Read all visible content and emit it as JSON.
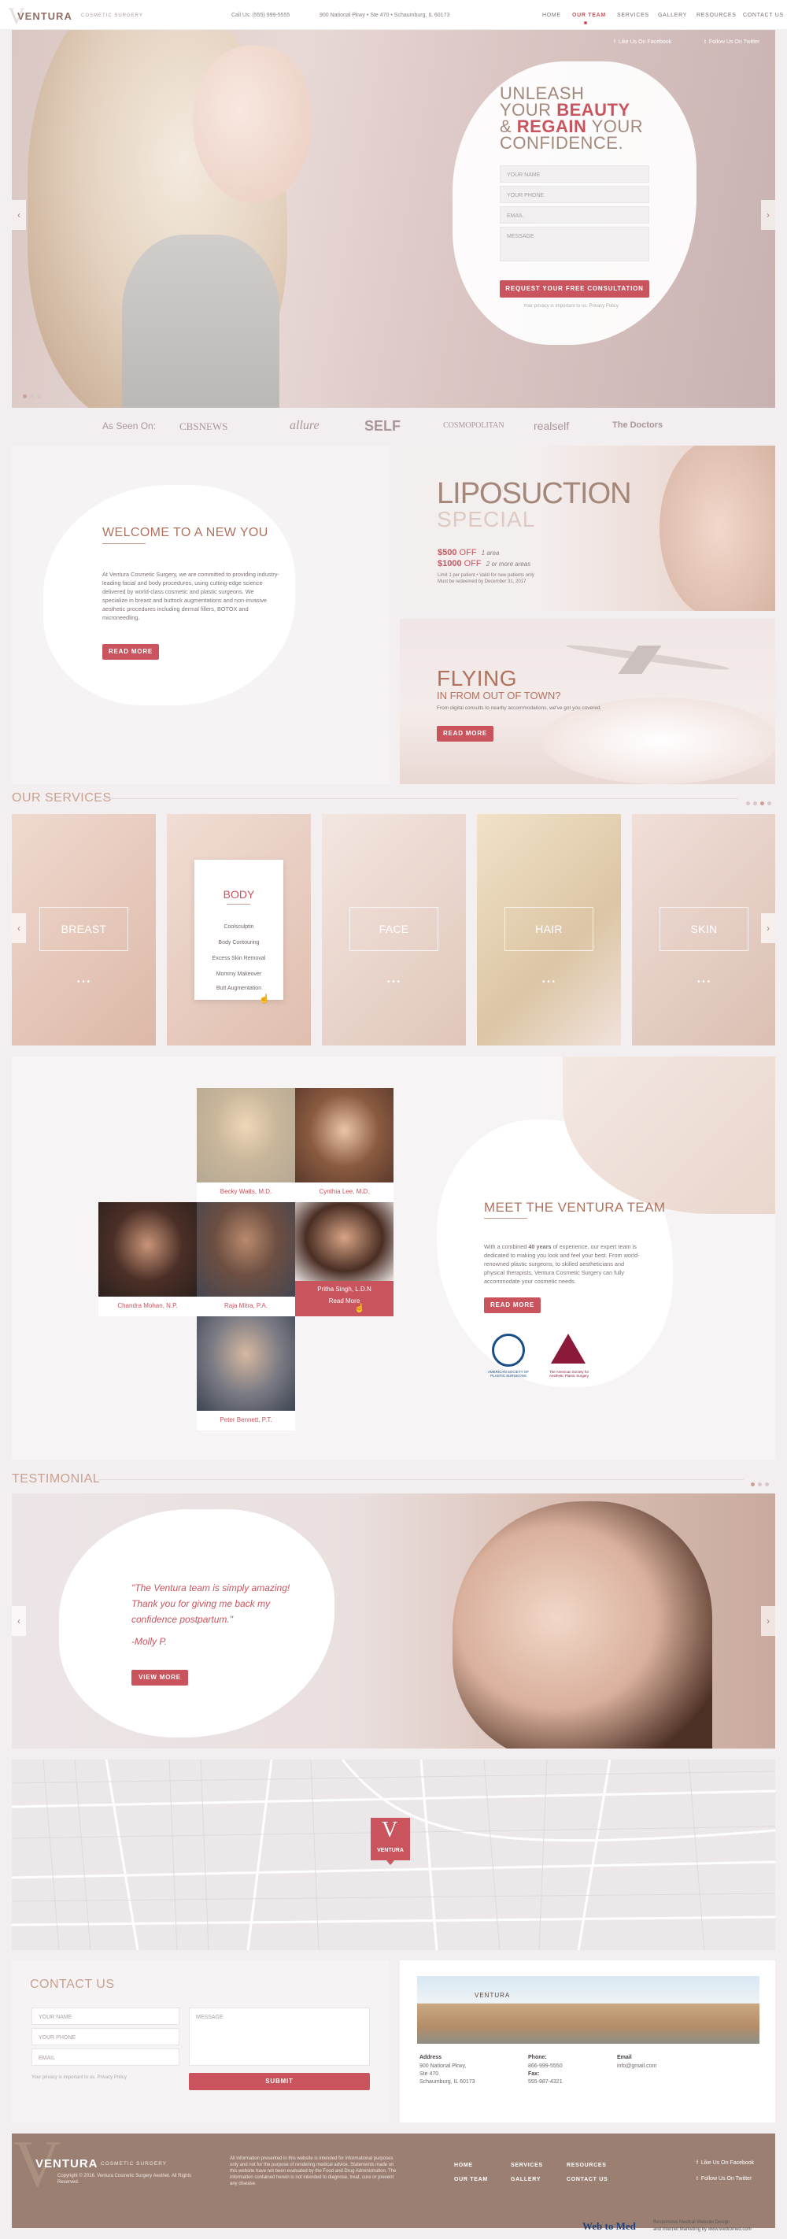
{
  "header": {
    "brand": "VENTURA",
    "brand_sub": "COSMETIC SURGERY",
    "phone": "Call Us: (555) 999-5555",
    "address": "900 National Pkwy  •  Ste 470  •  Schaumburg, IL 60173",
    "nav": [
      "HOME",
      "OUR TEAM",
      "SERVICES",
      "GALLERY",
      "RESOURCES",
      "CONTACT US"
    ]
  },
  "hero": {
    "social": [
      "Like Us On Facebook",
      "Follow Us On Twitter"
    ],
    "headline_1": "UNLEASH",
    "headline_2a": "YOUR ",
    "headline_2b": "BEAUTY",
    "headline_3a": "& ",
    "headline_3b": "REGAIN",
    "headline_3c": " YOUR",
    "headline_4": "CONFIDENCE.",
    "form": {
      "name": "YOUR NAME",
      "phone": "YOUR PHONE",
      "email": "EMAIL",
      "message": "MESSAGE",
      "submit": "REQUEST YOUR FREE CONSULTATION",
      "privacy": "Your privacy is important to us. Privacy Policy"
    }
  },
  "as_seen_on": {
    "label": "As Seen On:",
    "logos": [
      "CBSNEWS",
      "allure",
      "SELF",
      "COSMOPOLITAN",
      "realself",
      "The Doctors"
    ]
  },
  "welcome": {
    "title": "WELCOME TO A NEW YOU",
    "body": "At Ventura Cosmetic Surgery, we are committed to providing industry-leading facial and body procedures, using cutting-edge science delivered by world-class cosmetic and plastic surgeons. We specialize in breast and buttock augmentations and non-invasive aesthetic procedures including dermal fillers, BOTOX and microneedling.",
    "button": "READ MORE"
  },
  "lipo": {
    "title_1": "LIPOSUCTION",
    "title_2": "SPECIAL",
    "offer_1_price": "$500",
    "offer_1_off": " OFF",
    "offer_1_note": "1 area",
    "offer_2_price": "$1000",
    "offer_2_off": " OFF",
    "offer_2_note": "2 or more areas",
    "fine_print_1": "Limit 1 per patient  •  Valid for new patients only",
    "fine_print_2": "Must be redeemed by December 31, 2017"
  },
  "flying": {
    "title": "FLYING",
    "subtitle": "IN FROM OUT OF TOWN?",
    "body": "From digital consults to nearby accommodations, we've got you covered.",
    "button": "READ MORE"
  },
  "services": {
    "title": "OUR SERVICES",
    "cards": [
      "BREAST",
      "BODY",
      "FACE",
      "HAIR",
      "SKIN"
    ],
    "body_menu": [
      "Coolsculptin",
      "Body Contouring",
      "Excess Skin Removal",
      "Mommy Makeover",
      "Butt Augmentation"
    ]
  },
  "team": {
    "title": "MEET THE VENTURA TEAM",
    "body_a": "With a combined ",
    "body_b": "40 years",
    "body_c": " of experience, our expert team is dedicated to making you look and feel your best. From world-renowned plastic surgeons, to skilled aestheticians and physical therapists, Ventura Cosmetic Surgery can fully accommodate your cosmetic needs.",
    "button": "READ MORE",
    "members": [
      "Becky Watts, M.D.",
      "Cynthia Lee, M.D.",
      "Chandra Mohan, N.P.",
      "Raja Mitra, P.A.",
      "Pritha Singh, L.D.N",
      "Peter Bennett, P.T."
    ],
    "active_more": "Read More",
    "badge_1": "AMERICAN SOCIETY OF PLASTIC SURGEONS",
    "badge_2": "The American Society for Aesthetic Plastic Surgery"
  },
  "testimonial": {
    "title": "TESTIMONIAL",
    "quote": "\"The Ventura team is simply amazing! Thank you for giving me back my confidence postpartum.\"",
    "author": "-Molly P.",
    "button": "VIEW MORE"
  },
  "map": {
    "pin": "VENTURA"
  },
  "contact": {
    "title": "CONTACT US",
    "name": "YOUR NAME",
    "phone": "YOUR PHONE",
    "email": "EMAIL",
    "message": "MESSAGE",
    "privacy": "Your privacy is important to us. Privacy Policy",
    "submit": "SUBMIT",
    "address_label": "Address",
    "address_1": "900 National Pkwy,",
    "address_2": "Ste 470",
    "address_3": "Schaumburg, IL 60173",
    "phone_label": "Phone:",
    "phone_value": "866-999-5550",
    "fax_label": "Fax:",
    "fax_value": "555-987-4321",
    "email_label": "Email",
    "email_value": "info@gmail.com",
    "building_sign": "VENTURA"
  },
  "footer": {
    "brand": "VENTURA",
    "brand_sub": "COSMETIC SURGERY",
    "copyright": "Copyright © 2016. Ventura Cosmetic Surgery Aesthet. All Rights Reserved.",
    "disclaimer": "All information presented in this website is intended for informational purposes only and not for the purpose of rendering medical advice. Statements made on this website have not been evaluated by the Food and Drug Administration. The information contained herein is not intended to diagnose, treat, cure or prevent any disease.",
    "links": [
      "HOME",
      "OUR TEAM",
      "SERVICES",
      "GALLERY",
      "RESOURCES",
      "CONTACT US"
    ],
    "social": [
      "Like Us On Facebook",
      "Follow Us On Twitter"
    ],
    "webtomed": "Web to Med",
    "webtomed_1": "Responsive Medical Website Design",
    "webtomed_2": "and Internet Marketing by www.webtomed.com"
  },
  "colors": {
    "accent": "#c9545d",
    "taupe": "#9b7f73",
    "gold": "#c9a08f",
    "bg": "#f3eff1"
  }
}
